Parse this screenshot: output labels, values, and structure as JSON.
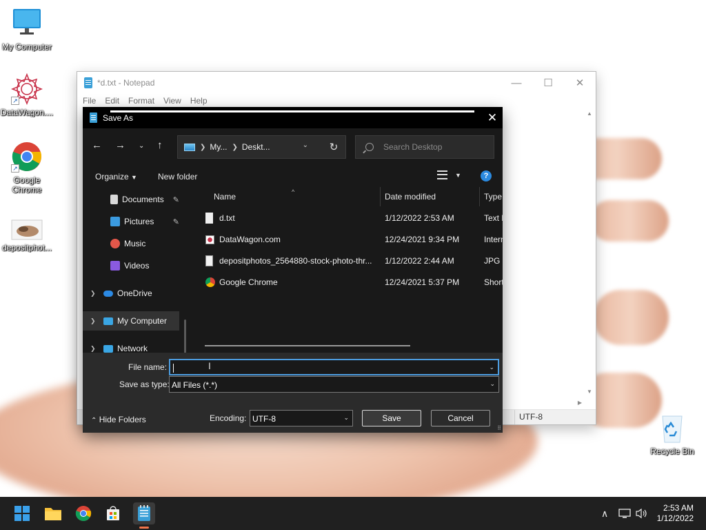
{
  "desktop": {
    "icons": [
      {
        "label": "My Computer",
        "icon": "monitor-icon"
      },
      {
        "label": "DataWagon....",
        "icon": "mandala-icon"
      },
      {
        "label": "Google Chrome",
        "icon": "chrome-icon"
      },
      {
        "label": "depositphot...",
        "icon": "photo-thumbnail-icon"
      },
      {
        "label": "Recycle Bin",
        "icon": "recycle-bin-icon"
      }
    ]
  },
  "notepad": {
    "title": "*d.txt - Notepad",
    "menu": [
      "File",
      "Edit",
      "Format",
      "View",
      "Help"
    ],
    "controls": {
      "minimize": "—",
      "maximize": "☐",
      "close": "✕"
    },
    "status_encoding": "UTF-8"
  },
  "dialog": {
    "title": "Save As",
    "address": {
      "crumbs": [
        "My...",
        "Deskt..."
      ]
    },
    "search_placeholder": "Search Desktop",
    "organize_label": "Organize",
    "new_folder_label": "New folder",
    "help_label": "?",
    "nav_items": [
      {
        "label": "Documents",
        "icon": "documents-icon",
        "color": "#d9d9d9",
        "pinned": true
      },
      {
        "label": "Pictures",
        "icon": "pictures-icon",
        "color": "#3b9be0",
        "pinned": true
      },
      {
        "label": "Music",
        "icon": "music-icon",
        "color": "#e4574a",
        "pinned": false
      },
      {
        "label": "Videos",
        "icon": "videos-icon",
        "color": "#8a5ae0",
        "pinned": false
      },
      {
        "label": "OneDrive",
        "icon": "onedrive-icon",
        "color": "#2c8ae4",
        "expandable": true
      },
      {
        "label": "My Computer",
        "icon": "computer-icon",
        "color": "#3aa6e4",
        "expandable": true,
        "selected": true
      },
      {
        "label": "Network",
        "icon": "network-icon",
        "color": "#3aa6e4",
        "expandable": true
      }
    ],
    "columns": {
      "name": "Name",
      "date": "Date modified",
      "type": "Type"
    },
    "files": [
      {
        "name": "d.txt",
        "date": "1/12/2022 2:53 AM",
        "type": "Text D",
        "icon": "text-file-icon"
      },
      {
        "name": "DataWagon.com",
        "date": "12/24/2021 9:34 PM",
        "type": "Intern",
        "icon": "internet-shortcut-icon"
      },
      {
        "name": "depositphotos_2564880-stock-photo-thr...",
        "date": "1/12/2022 2:44 AM",
        "type": "JPG F",
        "icon": "image-file-icon"
      },
      {
        "name": "Google Chrome",
        "date": "12/24/2021 5:37 PM",
        "type": "Short",
        "icon": "chrome-shortcut-icon"
      }
    ],
    "file_name_label": "File name:",
    "file_name_value": "",
    "save_type_label": "Save as type:",
    "save_type_value": "All Files  (*.*)",
    "hide_folders_label": "Hide Folders",
    "encoding_label": "Encoding:",
    "encoding_value": "UTF-8",
    "save_button": "Save",
    "cancel_button": "Cancel"
  },
  "taskbar": {
    "apps": [
      "start-icon",
      "file-explorer-icon",
      "chrome-icon",
      "store-icon",
      "notepad-icon"
    ],
    "clock_time": "2:53 AM",
    "clock_date": "1/12/2022",
    "tray_chevron": "∧"
  },
  "colors": {
    "dialog_bg": "#191919",
    "bottom_bg": "#2b2b2b",
    "accent": "#4d9de0",
    "taskbar_bg": "#202020"
  }
}
